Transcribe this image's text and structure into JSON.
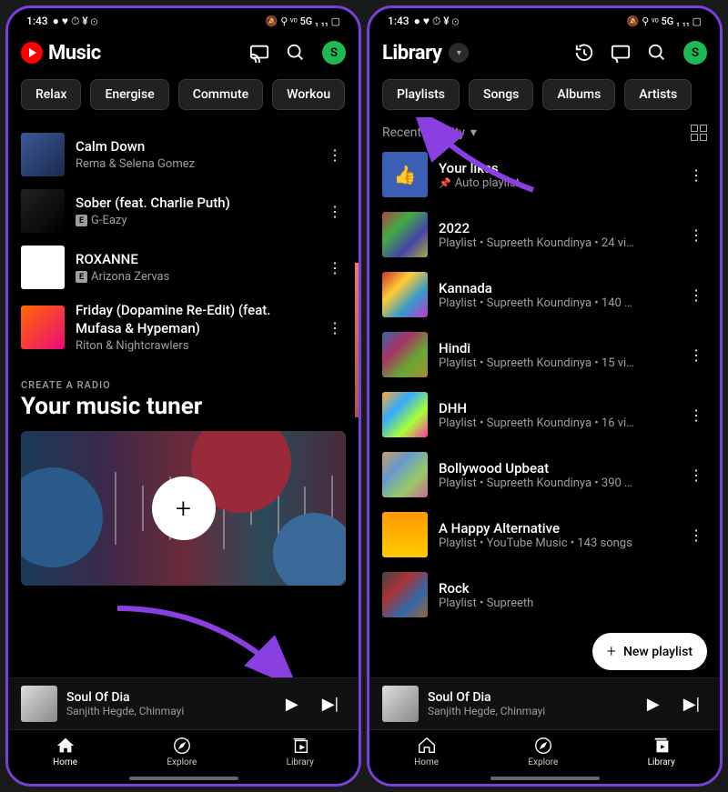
{
  "status": {
    "time": "1:43",
    "icons_left": "● ♥ ⏱ ¥ ⊙",
    "icons_right": "🔕 ⚲ ᵛᵒ 5G ₁ ₁₁ ▢"
  },
  "left": {
    "app_title": "Music",
    "avatar_letter": "S",
    "chips": [
      "Relax",
      "Energise",
      "Commute",
      "Workou"
    ],
    "songs": [
      {
        "title": "Calm Down",
        "meta": "Rema & Selena Gomez",
        "explicit": false,
        "wrap": false
      },
      {
        "title": "Sober (feat. Charlie Puth)",
        "meta": "G-Eazy",
        "explicit": true,
        "wrap": false
      },
      {
        "title": "ROXANNE",
        "meta": "Arizona Zervas",
        "explicit": true,
        "wrap": false
      },
      {
        "title": "Friday (Dopamine Re-Edit) (feat. Mufasa  & Hypeman)",
        "meta": "Riton & Nightcrawlers",
        "explicit": false,
        "wrap": true
      }
    ],
    "eyebrow": "CREATE A RADIO",
    "tuner_title": "Your music tuner",
    "mini": {
      "title": "Soul Of Dia",
      "artist": "Sanjith Hegde, Chinmayi"
    },
    "nav": {
      "home": "Home",
      "explore": "Explore",
      "library": "Library"
    }
  },
  "right": {
    "title": "Library",
    "avatar_letter": "S",
    "chips": [
      "Playlists",
      "Songs",
      "Albums",
      "Artists"
    ],
    "sort_label": "Recent activity",
    "playlists": [
      {
        "title": "Your likes",
        "meta": "Auto playlist",
        "likes": true
      },
      {
        "title": "2022",
        "meta": "Playlist • Supreeth Koundinya • 24 vi…"
      },
      {
        "title": "Kannada",
        "meta": "Playlist • Supreeth Koundinya • 140 …"
      },
      {
        "title": "Hindi",
        "meta": "Playlist • Supreeth Koundinya • 15 vi…"
      },
      {
        "title": "DHH",
        "meta": "Playlist • Supreeth Koundinya • 16 vi…"
      },
      {
        "title": "Bollywood Upbeat",
        "meta": "Playlist • Supreeth Koundinya • 390 …"
      },
      {
        "title": "A Happy Alternative",
        "meta": "Playlist • YouTube Music • 143 songs"
      },
      {
        "title": "Rock",
        "meta": "Playlist • Supreeth"
      }
    ],
    "new_playlist": "New playlist",
    "mini": {
      "title": "Soul Of Dia",
      "artist": "Sanjith Hegde, Chinmayi"
    },
    "nav": {
      "home": "Home",
      "explore": "Explore",
      "library": "Library"
    }
  }
}
